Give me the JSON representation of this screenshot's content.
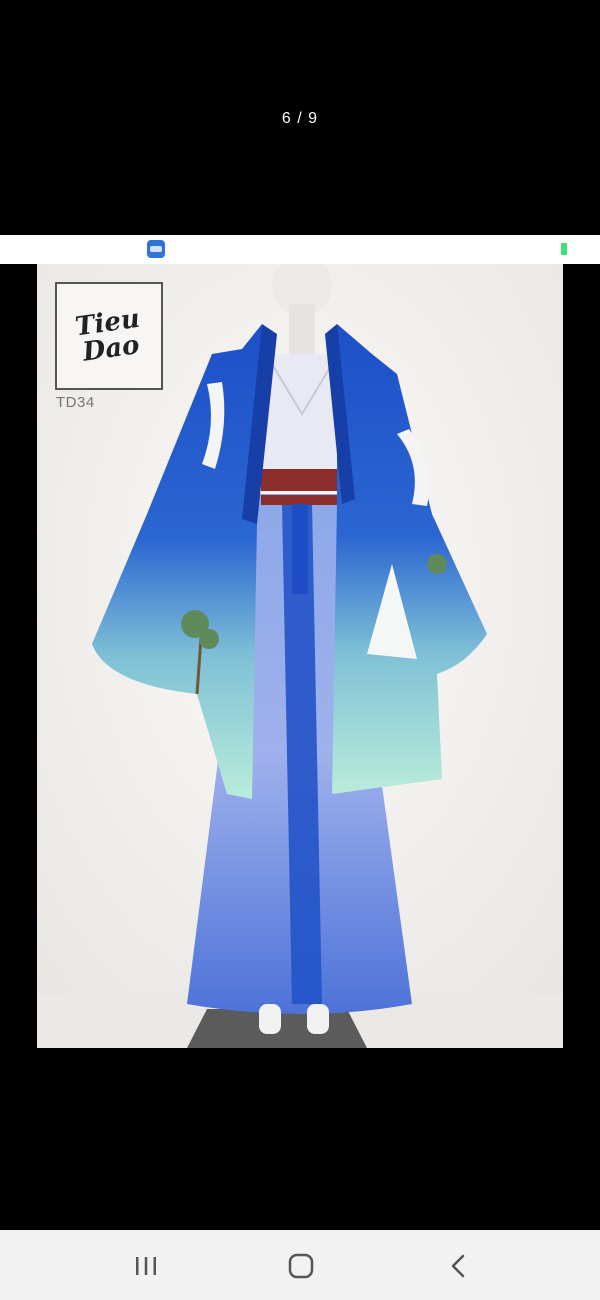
{
  "viewer": {
    "counter": "6 / 9"
  },
  "colors": {
    "background": "#000000",
    "accent_blue": "#1f52c4",
    "embedded_bar": "#ffffff",
    "battery": "#3ce07a"
  },
  "photo": {
    "description_icon": "robe-on-mannequin",
    "logo_line1": "Tieu",
    "logo_line2": "Dao",
    "product_code": "TD34"
  },
  "navigation": {
    "recent_icon": "recent-apps-icon",
    "home_icon": "home-icon",
    "back_icon": "back-icon"
  }
}
